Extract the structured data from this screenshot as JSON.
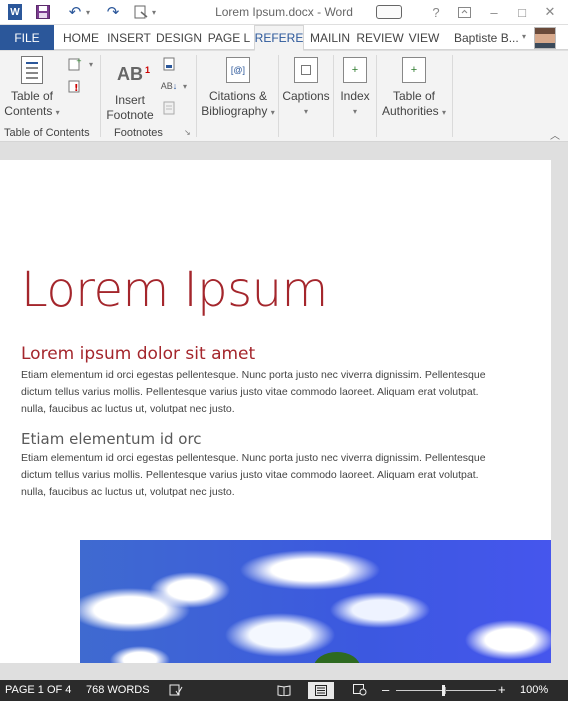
{
  "window": {
    "title": "Lorem Ipsum.docx - Word",
    "help": "?",
    "minimize": "–",
    "maximize": "□",
    "close": "✕"
  },
  "tabs": {
    "file": "FILE",
    "items": [
      "HOME",
      "INSERT",
      "DESIGN",
      "PAGE L",
      "REFERE",
      "MAILIN",
      "REVIEW",
      "VIEW"
    ],
    "active_index": 4
  },
  "user": {
    "name": "Baptiste B..."
  },
  "ribbon": {
    "toc_button": [
      "Table of",
      "Contents"
    ],
    "toc_group": "Table of Contents",
    "footnote_button": [
      "Insert",
      "Footnote"
    ],
    "footnotes_group": "Footnotes",
    "citations_button": [
      "Citations &",
      "Bibliography"
    ],
    "captions_button": "Captions",
    "index_button": "Index",
    "toa_button": [
      "Table of",
      "Authorities"
    ]
  },
  "document": {
    "title": "Lorem Ipsum",
    "heading1": "Lorem ipsum dolor sit amet",
    "para1": [
      "Etiam elementum id orci egestas pellentesque. Nunc porta justo nec viverra dignissim. Pellentesque",
      "dictum tellus varius mollis. Pellentesque varius justo vitae commodo laoreet. Aliquam erat volutpat.",
      "nulla, faucibus ac luctus ut, volutpat nec justo."
    ],
    "heading2": "Etiam elementum id orc",
    "para2": [
      "Etiam elementum id orci egestas pellentesque. Nunc porta justo nec viverra dignissim. Pellentesque",
      "dictum tellus varius mollis. Pellentesque varius justo vitae commodo laoreet. Aliquam erat volutpat.",
      "nulla, faucibus ac luctus ut, volutpat nec justo."
    ]
  },
  "status": {
    "page": "PAGE 1 OF 4",
    "words": "768 WORDS",
    "zoom": "100%",
    "zoom_minus": "–",
    "zoom_plus": "+"
  },
  "colors": {
    "accent": "#2b579a",
    "title_red": "#a4262c",
    "statusbar": "#2b2b2b"
  }
}
